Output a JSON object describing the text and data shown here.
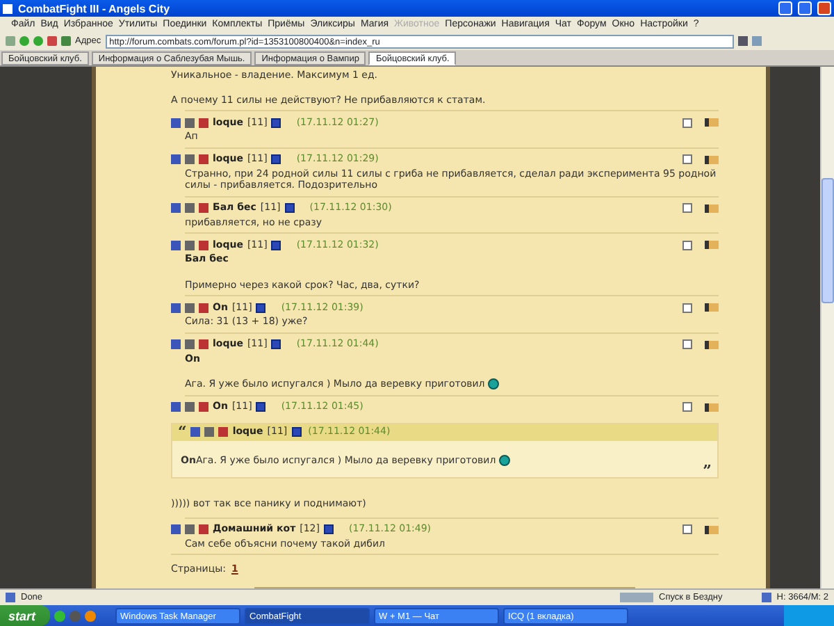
{
  "window": {
    "title": "CombatFight III - Angels City"
  },
  "menu": [
    {
      "label": "Файл",
      "disabled": false
    },
    {
      "label": "Вид",
      "disabled": false
    },
    {
      "label": "Избранное",
      "disabled": false
    },
    {
      "label": "Утилиты",
      "disabled": false
    },
    {
      "label": "Поединки",
      "disabled": false
    },
    {
      "label": "Комплекты",
      "disabled": false
    },
    {
      "label": "Приёмы",
      "disabled": false
    },
    {
      "label": "Эликсиры",
      "disabled": false
    },
    {
      "label": "Магия",
      "disabled": false
    },
    {
      "label": "Животное",
      "disabled": true
    },
    {
      "label": "Персонажи",
      "disabled": false
    },
    {
      "label": "Навигация",
      "disabled": false
    },
    {
      "label": "Чат",
      "disabled": false
    },
    {
      "label": "Форум",
      "disabled": false
    },
    {
      "label": "Окно",
      "disabled": false
    },
    {
      "label": "Настройки",
      "disabled": false
    },
    {
      "label": "?",
      "disabled": false
    }
  ],
  "address": {
    "label": "Адрес",
    "url": "http://forum.combats.com/forum.pl?id=1353100800400&n=index_ru"
  },
  "tabs": [
    {
      "label": "Бойцовский клуб.",
      "selected": false
    },
    {
      "label": "Информация о Саблезубая Мышь.",
      "selected": false
    },
    {
      "label": "Информация о Вампир",
      "selected": false
    },
    {
      "label": "Бойцовский клуб.",
      "selected": true
    }
  ],
  "intro": [
    "Уникальное - владение. Максимум 1 ед.",
    "А почему 11 силы не действуют? Не прибавляются к статам."
  ],
  "posts": [
    {
      "author": "loque",
      "level": "[11]",
      "time": "(17.11.12 01:27)",
      "text": "Ап",
      "checked": false
    },
    {
      "author": "loque",
      "level": "[11]",
      "time": "(17.11.12 01:29)",
      "text": "Странно, при 24 родной силы 11 силы с гриба не прибавляется, сделал ради эксперимента 95 родной силы - прибавляется. Подозрительно",
      "checked": false
    },
    {
      "author": "Бал бес",
      "level": "[11]",
      "time": "(17.11.12 01:30)",
      "text": "прибавляется, но не сразу",
      "checked": false
    },
    {
      "author": "loque",
      "level": "[11]",
      "time": "(17.11.12 01:32)",
      "reply_to": "Бал бес",
      "text": "Примерно через какой срок? Час, два, сутки?",
      "checked": false
    },
    {
      "author": "On",
      "level": "[11]",
      "time": "(17.11.12 01:39)",
      "text": "Сила: 31 (13 + 18) уже?",
      "checked": false
    },
    {
      "author": "loque",
      "level": "[11]",
      "time": "(17.11.12 01:44)",
      "reply_to": "On",
      "text": "Ага. Я уже было испугался ) Мыло да веревку приготовил",
      "smiley": true,
      "checked": false
    },
    {
      "author": "On",
      "level": "[11]",
      "time": "(17.11.12 01:45)",
      "quote": {
        "open_mark": "“",
        "author": "loque",
        "level": "[11]",
        "time": "(17.11.12 01:44)",
        "lead": "On",
        "text": "Ага. Я уже было испугался ) Мыло да веревку приготовил",
        "smiley": true,
        "close_mark": "”"
      },
      "text": "))))) вот так все панику и поднимают)",
      "checked": false
    },
    {
      "author": "Домашний кот",
      "level": "[12]",
      "time": "(17.11.12 01:49)",
      "text": "Сам себе объясни почему такой дибил",
      "checked": false
    }
  ],
  "pages": {
    "label": "Страницы:",
    "items": [
      {
        "label": "1",
        "selected": true
      }
    ]
  },
  "status_bar": {
    "text": "Done",
    "location": "Спуск в Бездну",
    "stats": "H: 3664/M: 2"
  },
  "taskbar": {
    "start": "start",
    "tasks": [
      {
        "label": "Windows Task Manager",
        "selected": false
      },
      {
        "label": "CombatFight",
        "selected": true
      },
      {
        "label": "W + M1 — Чат",
        "selected": false
      },
      {
        "label": "ICQ (1 вкладка)",
        "selected": false
      }
    ]
  }
}
